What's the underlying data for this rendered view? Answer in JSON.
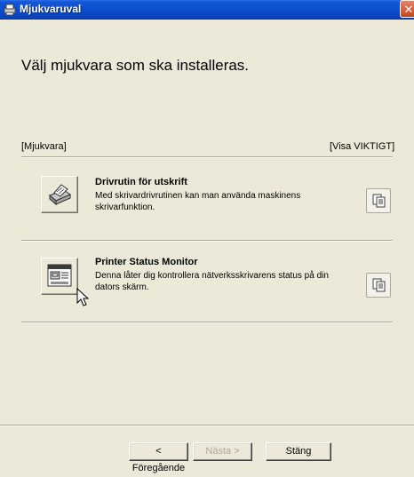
{
  "window": {
    "title": "Mjukvaruval",
    "close_label": "✕"
  },
  "heading": "Välj mjukvara som ska installeras.",
  "list": {
    "left_header": "[Mjukvara]",
    "right_header": "[Visa VIKTIGT]",
    "items": [
      {
        "title": "Drivrutin för utskrift",
        "description": "Med skrivardrivrutinen kan man använda maskinens skrivarfunktion.",
        "icon": "printer-icon",
        "doc_icon": "document-icon"
      },
      {
        "title": "Printer Status Monitor",
        "description": "Denna låter dig kontrollera nätverksskrivarens status på din dators skärm.",
        "icon": "status-monitor-icon",
        "doc_icon": "document-icon"
      }
    ]
  },
  "buttons": {
    "back": "< Föregående",
    "next": "Nästa >",
    "close": "Stäng"
  },
  "colors": {
    "titlebar": "#0a4ed0",
    "dialog_bg": "#ece9d8"
  }
}
